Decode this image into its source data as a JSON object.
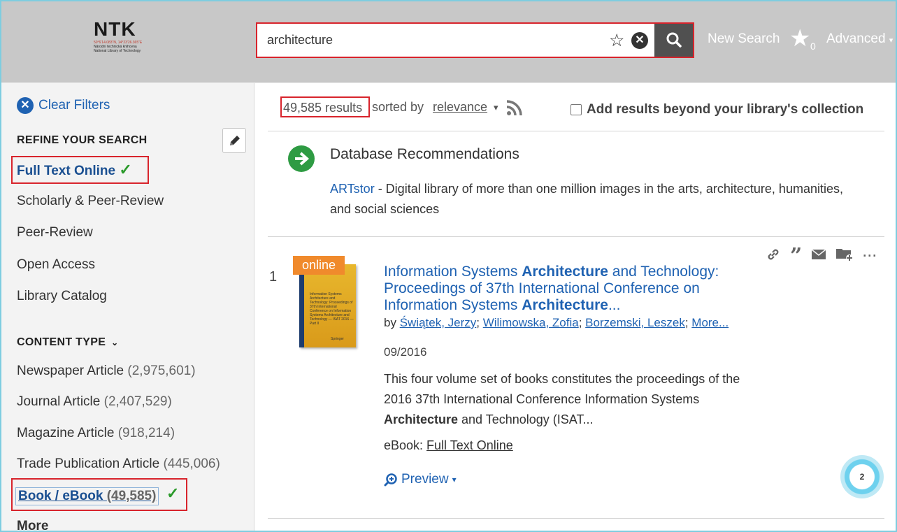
{
  "header": {
    "logo": {
      "name": "NTK",
      "coords": "50°6'14.083\"N, 14°23'26.365\"E",
      "line1": "Národní technická knihovna",
      "line2": "National Library of Technology"
    },
    "search": {
      "value": "architecture",
      "placeholder": ""
    },
    "new_search": "New Search",
    "saved_count": "0",
    "advanced": "Advanced"
  },
  "sidebar": {
    "clear_filters": "Clear Filters",
    "refine_title": "REFINE YOUR SEARCH",
    "refine_items": [
      "Full Text Online",
      "Scholarly & Peer-Review",
      "Peer-Review",
      "Open Access",
      "Library Catalog"
    ],
    "content_type_title": "CONTENT TYPE",
    "content_types": [
      {
        "label": "Newspaper Article",
        "count": "(2,975,601)"
      },
      {
        "label": "Journal Article",
        "count": "(2,407,529)"
      },
      {
        "label": "Magazine Article",
        "count": "(918,214)"
      },
      {
        "label": "Trade Publication Article",
        "count": "(445,006)"
      },
      {
        "label": "Book / eBook",
        "count": "(49,585)"
      }
    ],
    "more": "More"
  },
  "results_bar": {
    "count": "49,585 results",
    "sorted_by": "sorted by",
    "sort": "relevance",
    "beyond": "Add results beyond your library's collection"
  },
  "db_recs": {
    "title": "Database Recommendations",
    "link": "ARTstor",
    "desc": " - Digital library of more than one million images in the arts, architecture, humanities, and social sciences"
  },
  "result": {
    "number": "1",
    "badge": "online",
    "cover_text": "Information Systems Architecture and Technology: Proceedings of 37th International Conference on Information Systems Architecture and Technology — ISAT 2016 — Part II",
    "cover_publisher": "Springer",
    "title_parts": {
      "p1": "Information Systems ",
      "b1": "Architecture",
      "p2": " and Technology: Proceedings of 37th International Conference on Information Systems ",
      "b2": "Architecture",
      "p3": "..."
    },
    "by": "by ",
    "authors": [
      "Świątek, Jerzy",
      "Wilimowska, Zofia",
      "Borzemski, Leszek",
      "More..."
    ],
    "date": "09/2016",
    "abstract_p1": "This four volume set of books constitutes the proceedings of the 2016 37th International Conference Information Systems ",
    "abstract_b": "Architecture",
    "abstract_p2": " and Technology (ISAT...",
    "format_label": "eBook: ",
    "format_link": "Full Text Online",
    "preview": "Preview"
  },
  "help_bubble": {
    "count": "2"
  },
  "icons": [
    "star-icon",
    "clear-icon",
    "search-icon",
    "saved-star-icon",
    "pencil-icon",
    "check-icon",
    "rss-icon",
    "arrow-right-icon",
    "link-icon",
    "quote-icon",
    "mail-icon",
    "folder-add-icon",
    "more-icon",
    "magnifier-plus-icon"
  ]
}
